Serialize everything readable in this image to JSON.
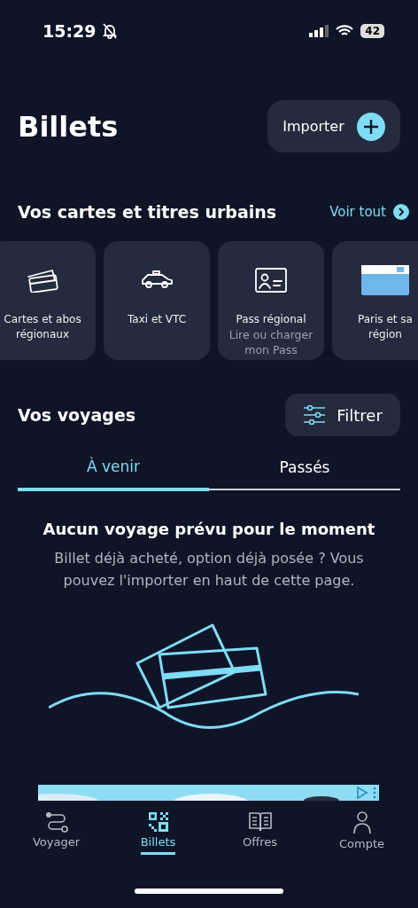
{
  "status_bar": {
    "time": "15:29",
    "battery": "42"
  },
  "header": {
    "title": "Billets",
    "import_button": "Importer"
  },
  "cards_section": {
    "title": "Vos cartes et titres urbains",
    "see_all": "Voir tout",
    "cards": [
      {
        "kind": "tickets",
        "title": "Cartes et abos régionaux"
      },
      {
        "kind": "taxi",
        "title": "Taxi et VTC"
      },
      {
        "kind": "idcard",
        "title": "Pass régional",
        "subtitle": "Lire ou charger mon Pass"
      },
      {
        "kind": "navigo",
        "title": "Paris et sa région"
      }
    ]
  },
  "trips": {
    "title": "Vos voyages",
    "filter_button": "Filtrer",
    "tabs": [
      {
        "label": "À venir",
        "selected": true
      },
      {
        "label": "Passés",
        "selected": false
      }
    ],
    "empty_title": "Aucun voyage prévu pour le moment",
    "empty_text": "Billet déjà acheté, option déjà posée ? Vous pouvez l'importer en haut de cette page."
  },
  "bottom_nav": [
    {
      "label": "Voyager",
      "selected": false
    },
    {
      "label": "Billets",
      "selected": true
    },
    {
      "label": "Offres",
      "selected": false
    },
    {
      "label": "Compte",
      "selected": false
    }
  ]
}
